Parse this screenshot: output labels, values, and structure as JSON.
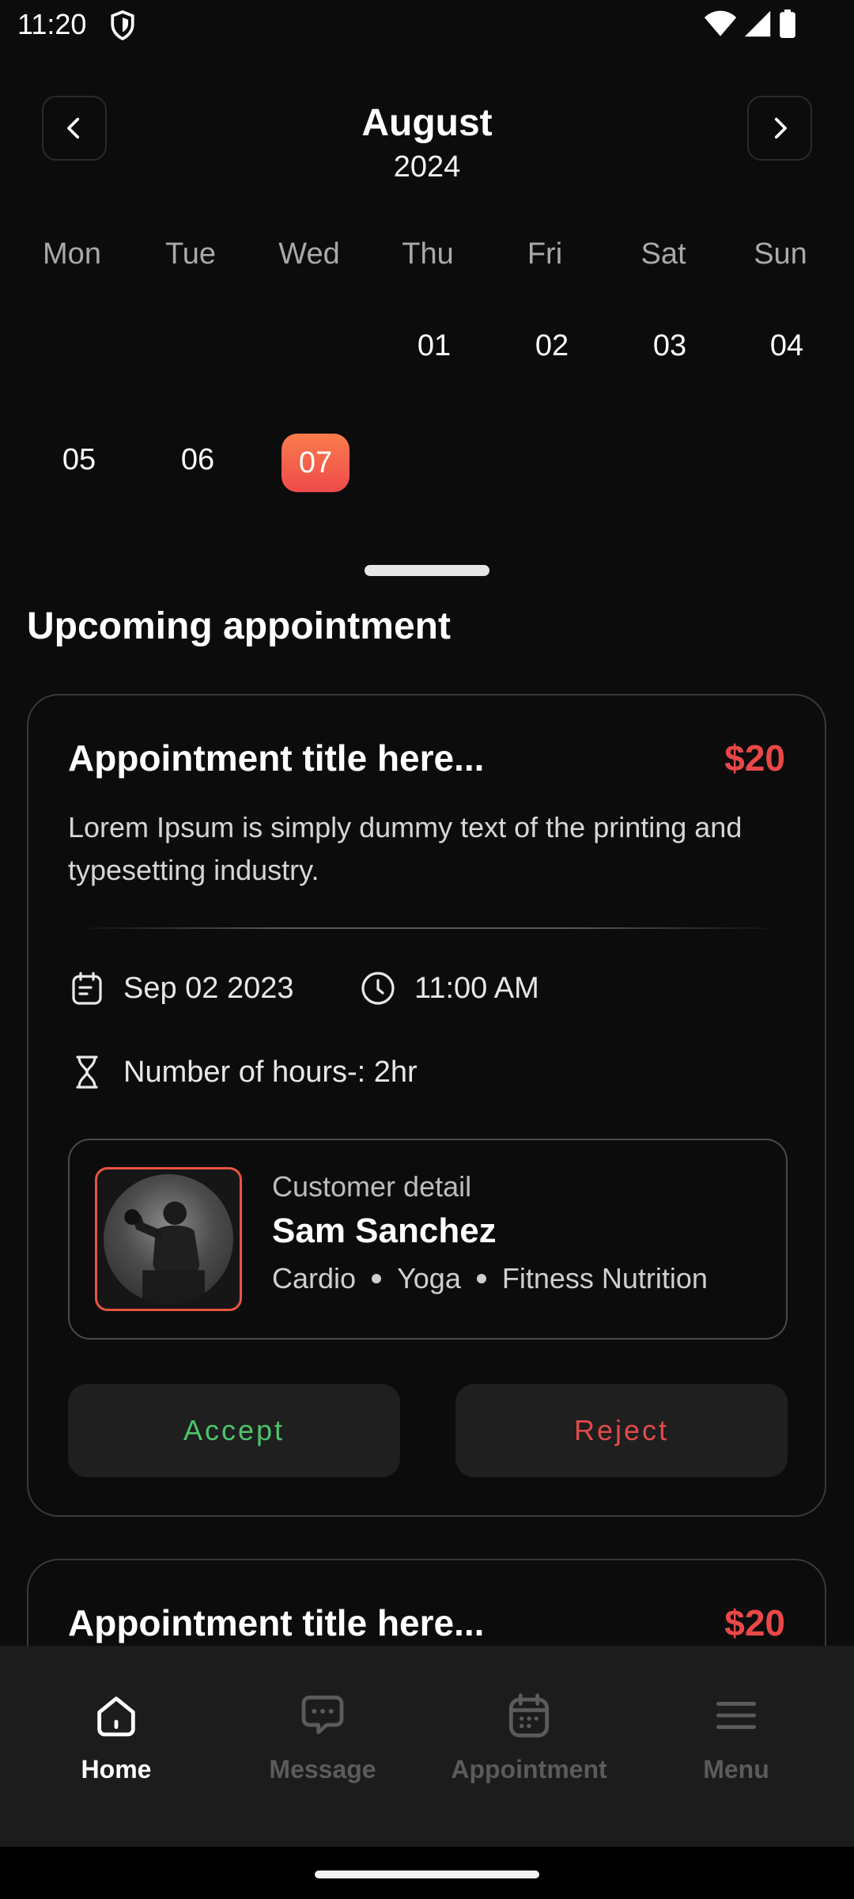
{
  "status_bar": {
    "time": "11:20"
  },
  "calendar": {
    "month": "August",
    "year": "2024",
    "weekdays": [
      "Mon",
      "Tue",
      "Wed",
      "Thu",
      "Fri",
      "Sat",
      "Sun"
    ],
    "week1": [
      "01",
      "02",
      "03",
      "04"
    ],
    "week2": [
      "05",
      "06",
      "07"
    ],
    "selected_day": "07"
  },
  "section_title": "Upcoming appointment",
  "appointments": [
    {
      "title": "Appointment title here...",
      "price": "$20",
      "description": "Lorem Ipsum is simply dummy text of the printing and typesetting industry.",
      "date": "Sep 02 2023",
      "time": "11:00 AM",
      "hours": "Number of hours-: 2hr",
      "customer": {
        "label": "Customer detail",
        "name": "Sam Sanchez",
        "tags": [
          "Cardio",
          "Yoga",
          "Fitness Nutrition"
        ]
      },
      "accept_label": "Accept",
      "reject_label": "Reject"
    },
    {
      "title": "Appointment title here...",
      "price": "$20"
    }
  ],
  "bottom_nav": [
    {
      "label": "Home",
      "icon": "home-icon",
      "active": true
    },
    {
      "label": "Message",
      "icon": "message-icon",
      "active": false
    },
    {
      "label": "Appointment",
      "icon": "calendar-icon",
      "active": false
    },
    {
      "label": "Menu",
      "icon": "menu-icon",
      "active": false
    }
  ],
  "colors": {
    "background": "#0c0c0c",
    "accent_gradient_start": "#f97d4c",
    "accent_gradient_end": "#ef4a4a",
    "price": "#ea4848",
    "accept": "#4cc46b",
    "reject": "#e24a4a"
  }
}
